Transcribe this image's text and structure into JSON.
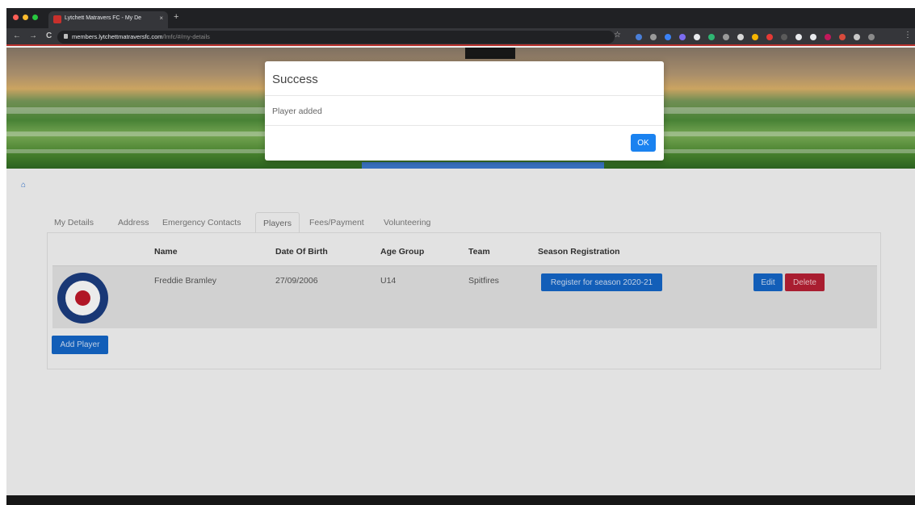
{
  "browser": {
    "tab_title": "Lytchett Matravers FC - My De",
    "tab_close": "×",
    "new_tab": "+",
    "url_host": "members.lytchettmatraversfc.com",
    "url_path": "/lmfc/#/my-details",
    "back": "←",
    "forward": "→",
    "reload": "C",
    "star": "☆",
    "menu": "⋮"
  },
  "page": {
    "home_icon": "⌂",
    "tabs": [
      "My Details",
      "Address",
      "Emergency Contacts",
      "Players",
      "Fees/Payment",
      "Volunteering"
    ],
    "active_tab": "Players",
    "table": {
      "headers": [
        "Name",
        "Date Of Birth",
        "Age Group",
        "Team",
        "Season Registration"
      ],
      "rows": [
        {
          "name": "Freddie Bramley",
          "dob": "27/09/2006",
          "age_group": "U14",
          "team": "Spitfires",
          "register_label": "Register for season 2020-21",
          "edit_label": "Edit",
          "delete_label": "Delete"
        }
      ]
    },
    "add_player_label": "Add Player"
  },
  "modal": {
    "title": "Success",
    "message": "Player added",
    "ok_label": "OK"
  },
  "colors": {
    "primary": "#1467c8",
    "danger": "#b82035",
    "modal_ok": "#1a82f0"
  }
}
